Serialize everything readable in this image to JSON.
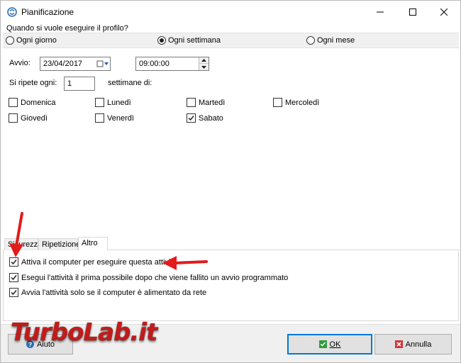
{
  "window": {
    "title": "Pianificazione"
  },
  "schedule": {
    "question": "Quando si vuole eseguire il profilo?",
    "options": [
      {
        "label": "Ogni giorno",
        "selected": false
      },
      {
        "label": "Ogni settimana",
        "selected": true
      },
      {
        "label": "Ogni mese",
        "selected": false
      }
    ],
    "start_label": "Avvio:",
    "start_date": "23/04/2017",
    "start_time": "09:00:00",
    "repeat_label": "Si ripete ogni:",
    "repeat_value": "1",
    "weeks_label": "settimane di:",
    "days": [
      {
        "label": "Domenica",
        "checked": false
      },
      {
        "label": "Lunedì",
        "checked": false
      },
      {
        "label": "Martedì",
        "checked": false
      },
      {
        "label": "Mercoledì",
        "checked": false
      },
      {
        "label": "Giovedì",
        "checked": false
      },
      {
        "label": "Venerdì",
        "checked": false
      },
      {
        "label": "Sabato",
        "checked": true
      }
    ]
  },
  "tabs": [
    {
      "label": "Sicurezza",
      "active": false
    },
    {
      "label": "Ripetizione",
      "active": false
    },
    {
      "label": "Altro",
      "active": true
    }
  ],
  "altro": [
    {
      "label": "Attiva il computer per eseguire questa attività",
      "checked": true
    },
    {
      "label": "Esegui l'attività il prima possibile dopo che viene fallito un avvio programmato",
      "checked": true
    },
    {
      "label": "Avvia l'attività solo se il computer è alimentato da rete",
      "checked": true
    }
  ],
  "buttons": {
    "help": "Aiuto",
    "ok": "OK",
    "cancel": "Annulla"
  },
  "watermark": "TurboLab.it",
  "colors": {
    "accent": "#0078d7",
    "arrow": "#e21b1b",
    "ok_icon": "#2e9e3a",
    "cancel_icon": "#d13438"
  }
}
